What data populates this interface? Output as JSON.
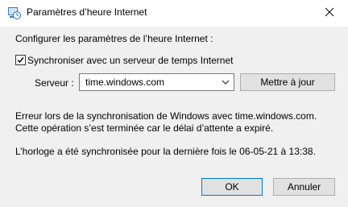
{
  "window": {
    "title": "Paramètres d’heure Internet"
  },
  "settings": {
    "heading": "Configurer les paramètres de l’heure Internet :",
    "sync_checkbox_label": "Synchroniser avec un serveur de temps Internet",
    "sync_checked": true,
    "server_label": "Serveur :",
    "server_value": "time.windows.com",
    "update_button": "Mettre à jour"
  },
  "status": {
    "error_line1": "Erreur lors de la synchronisation de Windows avec time.windows.com.",
    "error_line2": "Cette opération s’est terminée car le délai d’attente a expiré.",
    "last_sync": "L’horloge a été synchronisée pour la dernière fois le 06-05-21 à 13:38."
  },
  "buttons": {
    "ok": "OK",
    "cancel": "Annuler"
  },
  "colors": {
    "dialog_bg": "#f0f0f0",
    "titlebar_bg": "#ffffff",
    "default_button_border": "#0078d7"
  }
}
